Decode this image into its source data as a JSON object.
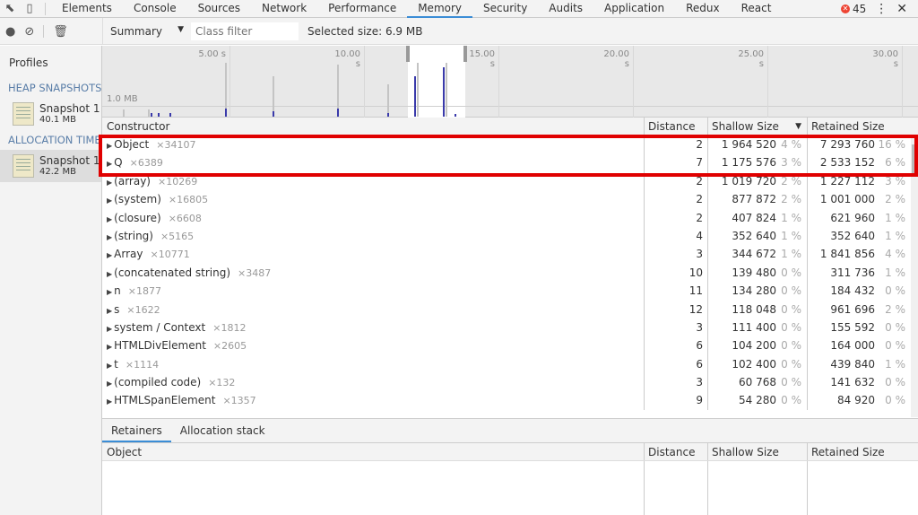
{
  "tabs": {
    "items": [
      "Elements",
      "Console",
      "Sources",
      "Network",
      "Performance",
      "Memory",
      "Security",
      "Audits",
      "Application",
      "Redux",
      "React"
    ],
    "active": "Memory",
    "error_count": "45"
  },
  "toolbar": {
    "view": "Summary",
    "class_filter_placeholder": "Class filter",
    "selected_size": "Selected size: 6.9 MB"
  },
  "sidebar": {
    "title": "Profiles",
    "heap_header": "HEAP SNAPSHOTS",
    "alloc_header": "ALLOCATION TIMELINES",
    "heap": [
      {
        "name": "Snapshot 1",
        "size": "40.1 MB"
      }
    ],
    "alloc": [
      {
        "name": "Snapshot 1",
        "size": "42.2 MB"
      }
    ]
  },
  "overview": {
    "ticks": [
      "5.00 s",
      "10.00 s",
      "15.00 s",
      "20.00 s",
      "25.00 s",
      "30.00 s"
    ],
    "scale_label": "1.0 MB",
    "accent": "#3a3aaa"
  },
  "grid": {
    "headers": {
      "constructor": "Constructor",
      "distance": "Distance",
      "shallow": "Shallow Size",
      "retained": "Retained Size"
    },
    "sort": "Shallow Size descending",
    "rows": [
      {
        "name": "Object",
        "count": "×34107",
        "distance": "2",
        "shallow": "1 964 520",
        "shallow_pct": "4 %",
        "retained": "7 293 760",
        "retained_pct": "16 %"
      },
      {
        "name": "Q",
        "count": "×6389",
        "distance": "7",
        "shallow": "1 175 576",
        "shallow_pct": "3 %",
        "retained": "2 533 152",
        "retained_pct": "6 %"
      },
      {
        "name": "(array)",
        "count": "×10269",
        "distance": "2",
        "shallow": "1 019 720",
        "shallow_pct": "2 %",
        "retained": "1 227 112",
        "retained_pct": "3 %"
      },
      {
        "name": "(system)",
        "count": "×16805",
        "distance": "2",
        "shallow": "877 872",
        "shallow_pct": "2 %",
        "retained": "1 001 000",
        "retained_pct": "2 %"
      },
      {
        "name": "(closure)",
        "count": "×6608",
        "distance": "2",
        "shallow": "407 824",
        "shallow_pct": "1 %",
        "retained": "621 960",
        "retained_pct": "1 %"
      },
      {
        "name": "(string)",
        "count": "×5165",
        "distance": "4",
        "shallow": "352 640",
        "shallow_pct": "1 %",
        "retained": "352 640",
        "retained_pct": "1 %"
      },
      {
        "name": "Array",
        "count": "×10771",
        "distance": "3",
        "shallow": "344 672",
        "shallow_pct": "1 %",
        "retained": "1 841 856",
        "retained_pct": "4 %"
      },
      {
        "name": "(concatenated string)",
        "count": "×3487",
        "distance": "10",
        "shallow": "139 480",
        "shallow_pct": "0 %",
        "retained": "311 736",
        "retained_pct": "1 %"
      },
      {
        "name": "n",
        "count": "×1877",
        "distance": "11",
        "shallow": "134 280",
        "shallow_pct": "0 %",
        "retained": "184 432",
        "retained_pct": "0 %"
      },
      {
        "name": "s",
        "count": "×1622",
        "distance": "12",
        "shallow": "118 048",
        "shallow_pct": "0 %",
        "retained": "961 696",
        "retained_pct": "2 %"
      },
      {
        "name": "system / Context",
        "count": "×1812",
        "distance": "3",
        "shallow": "111 400",
        "shallow_pct": "0 %",
        "retained": "155 592",
        "retained_pct": "0 %"
      },
      {
        "name": "HTMLDivElement",
        "count": "×2605",
        "distance": "6",
        "shallow": "104 200",
        "shallow_pct": "0 %",
        "retained": "164 000",
        "retained_pct": "0 %"
      },
      {
        "name": "t",
        "count": "×1114",
        "distance": "6",
        "shallow": "102 400",
        "shallow_pct": "0 %",
        "retained": "439 840",
        "retained_pct": "1 %"
      },
      {
        "name": "(compiled code)",
        "count": "×132",
        "distance": "3",
        "shallow": "60 768",
        "shallow_pct": "0 %",
        "retained": "141 632",
        "retained_pct": "0 %"
      },
      {
        "name": "HTMLSpanElement",
        "count": "×1357",
        "distance": "9",
        "shallow": "54 280",
        "shallow_pct": "0 %",
        "retained": "84 920",
        "retained_pct": "0 %"
      }
    ]
  },
  "bottom": {
    "tabs": [
      "Retainers",
      "Allocation stack"
    ],
    "headers": {
      "object": "Object",
      "distance": "Distance",
      "shallow": "Shallow Size",
      "retained": "Retained Size"
    }
  },
  "highlight_color": "#e00000"
}
